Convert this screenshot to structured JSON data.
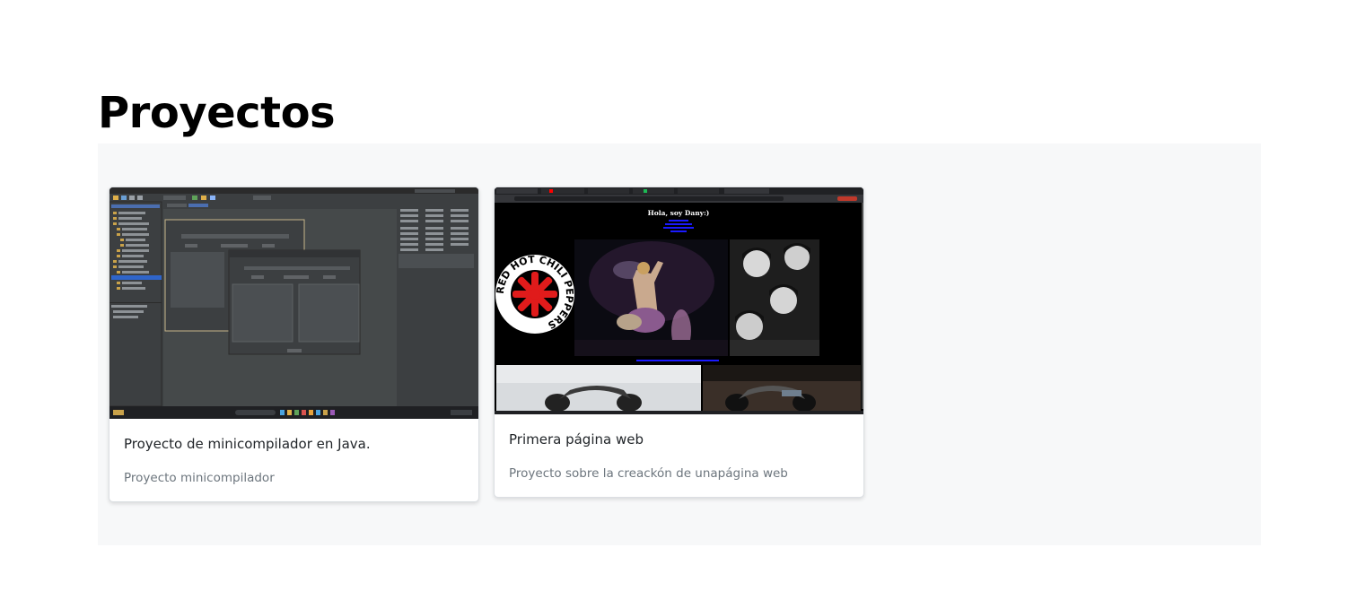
{
  "page": {
    "title": "Proyectos"
  },
  "projects": [
    {
      "title": "Proyecto de minicompilador en Java.",
      "description": "Proyecto minicompilador",
      "image": "netbeans-ide-screenshot"
    },
    {
      "title": "Primera página web",
      "description": "Proyecto sobre la creackón de unapágina web",
      "image": "webpage-screenshot",
      "image_text": {
        "greeting": "Hola, soy Dany:)",
        "logo_text": "RED HOT CHILI PEPPERS"
      }
    }
  ],
  "colors": {
    "panel_background": "#f7f8f9",
    "card_border": "#dcdfe3",
    "subtitle_text": "#6c757d"
  }
}
